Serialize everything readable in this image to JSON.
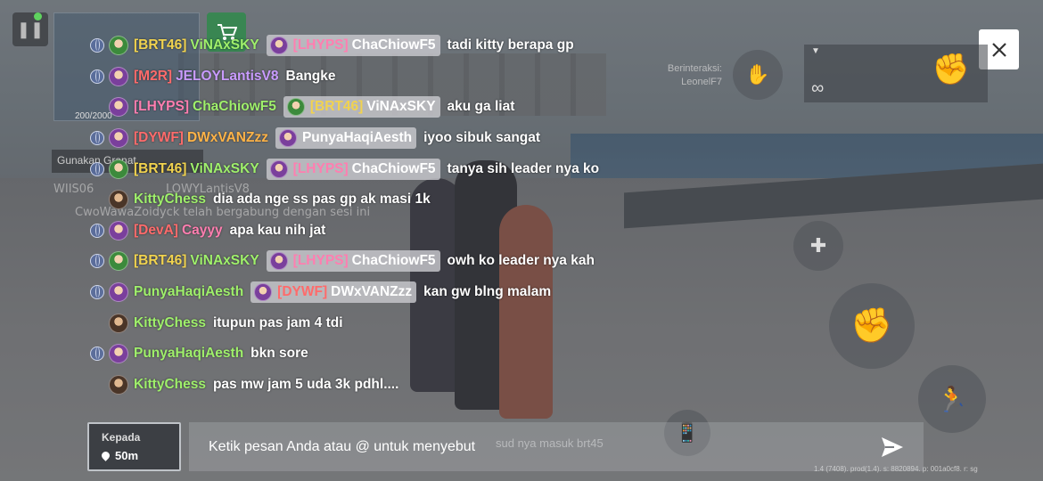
{
  "hud": {
    "pause_icon": "❚❚",
    "interact_label": "Berinteraksi:",
    "interact_target": "LeonelF7",
    "weapon_infinity": "∞",
    "build_info": "1.4 (7408). prod(1.4). s: 8820894. p: 001a0cf8. r: sg",
    "hint_label": "Gunakan Granat",
    "minimap_label": "200/2000",
    "sys_lines": [
      "WIIS06",
      "LOWYLantisV8",
      "CwoWawaZoidyck telah bergabung dengan sesi ini"
    ],
    "faded_msg": "sud nya masuk brt45"
  },
  "chat": {
    "messages": [
      {
        "globe": true,
        "avatar": "green",
        "tag": "[BRT46]",
        "tag_color": "#f1d34f",
        "name": "ViNAxSKY",
        "name_color": "#9ff06b",
        "mention": {
          "avatar": "purple",
          "tag": "[LHYPS]",
          "tag_color": "#ff7eb0",
          "name": "ChaChiowF5",
          "name_color": "#ffffff"
        },
        "text": "tadi kitty berapa gp"
      },
      {
        "globe": true,
        "avatar": "purple",
        "tag": "[M2R]",
        "tag_color": "#ff6b6b",
        "name": "JELOYLantisV8",
        "name_color": "#c99bff",
        "mention": null,
        "text": "Bangke"
      },
      {
        "globe": false,
        "avatar": "purple",
        "tag": "[LHYPS]",
        "tag_color": "#ff7eb0",
        "name": "ChaChiowF5",
        "name_color": "#9ff06b",
        "mention": {
          "avatar": "green",
          "tag": "[BRT46]",
          "tag_color": "#f1d34f",
          "name": "ViNAxSKY",
          "name_color": "#ffffff"
        },
        "text": "aku ga liat"
      },
      {
        "globe": true,
        "avatar": "purple",
        "tag": "[DYWF]",
        "tag_color": "#ff6b6b",
        "name": "DWxVANZzz",
        "name_color": "#ffb347",
        "mention": {
          "avatar": "purple",
          "tag": "",
          "tag_color": "#ffffff",
          "name": "PunyaHaqiAesth",
          "name_color": "#ffffff"
        },
        "text": "iyoo sibuk sangat"
      },
      {
        "globe": true,
        "avatar": "green",
        "tag": "[BRT46]",
        "tag_color": "#f1d34f",
        "name": "ViNAxSKY",
        "name_color": "#9ff06b",
        "mention": {
          "avatar": "purple",
          "tag": "[LHYPS]",
          "tag_color": "#ff7eb0",
          "name": "ChaChiowF5",
          "name_color": "#ffffff"
        },
        "text": "tanya sih leader nya ko"
      },
      {
        "globe": false,
        "avatar": "brown",
        "tag": "",
        "tag_color": "#ffffff",
        "name": "KittyChess",
        "name_color": "#9ff06b",
        "mention": null,
        "text": "dia ada nge ss pas gp ak masi 1k"
      },
      {
        "globe": true,
        "avatar": "purple",
        "tag": "[DevA]",
        "tag_color": "#ff6b6b",
        "name": "Cayyy",
        "name_color": "#ff7eb0",
        "mention": null,
        "text": "apa kau nih jat"
      },
      {
        "globe": true,
        "avatar": "green",
        "tag": "[BRT46]",
        "tag_color": "#f1d34f",
        "name": "ViNAxSKY",
        "name_color": "#9ff06b",
        "mention": {
          "avatar": "purple",
          "tag": "[LHYPS]",
          "tag_color": "#ff7eb0",
          "name": "ChaChiowF5",
          "name_color": "#ffffff"
        },
        "text": "owh ko leader nya kah"
      },
      {
        "globe": true,
        "avatar": "purple",
        "tag": "",
        "tag_color": "#ffffff",
        "name": "PunyaHaqiAesth",
        "name_color": "#9ff06b",
        "mention": {
          "avatar": "purple",
          "tag": "[DYWF]",
          "tag_color": "#ff6b6b",
          "name": "DWxVANZzz",
          "name_color": "#ffffff"
        },
        "text": "kan gw blng malam"
      },
      {
        "globe": false,
        "avatar": "brown",
        "tag": "",
        "tag_color": "#ffffff",
        "name": "KittyChess",
        "name_color": "#9ff06b",
        "mention": null,
        "text": "itupun pas jam 4 tdi"
      },
      {
        "globe": true,
        "avatar": "purple",
        "tag": "",
        "tag_color": "#ffffff",
        "name": "PunyaHaqiAesth",
        "name_color": "#9ff06b",
        "mention": null,
        "text": "bkn sore"
      },
      {
        "globe": false,
        "avatar": "brown",
        "tag": "",
        "tag_color": "#ffffff",
        "name": "KittyChess",
        "name_color": "#9ff06b",
        "mention": null,
        "text": "pas mw jam 5 uda 3k pdhl...."
      }
    ]
  },
  "bottom": {
    "to_label": "Kepada",
    "to_distance": "50m",
    "input_placeholder": "Ketik pesan Anda atau @ untuk menyebut",
    "input_value": ""
  }
}
